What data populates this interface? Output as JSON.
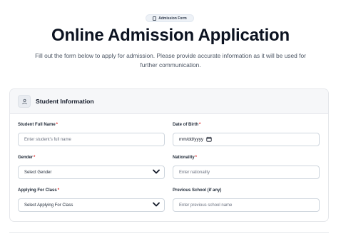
{
  "badge": {
    "label": "Admission Form",
    "icon": "document-icon"
  },
  "page": {
    "title": "Online Admission Application",
    "subtitle": "Fill out the form below to apply for admission. Please provide accurate information as it will be used for further communication."
  },
  "section": {
    "title": "Student Information",
    "icon": "user-icon"
  },
  "fields": {
    "full_name": {
      "label": "Student Full Name",
      "required_mark": "*",
      "placeholder": "Enter student's full name"
    },
    "dob": {
      "label": "Date of Birth",
      "required_mark": "*",
      "value": "mm/dd/yyyy",
      "icon": "calendar-icon"
    },
    "gender": {
      "label": "Gender",
      "required_mark": "*",
      "selected": "Select Gender",
      "icon": "chevron-down-icon"
    },
    "nationality": {
      "label": "Nationality",
      "required_mark": "*",
      "placeholder": "Enter nationality"
    },
    "class": {
      "label": "Applying For Class",
      "required_mark": "*",
      "selected": "Select Applying For Class",
      "icon": "chevron-down-icon"
    },
    "previous_school": {
      "label": "Previous School (if any)",
      "placeholder": "Enter previous school name"
    }
  },
  "colors": {
    "required": "#dc2626",
    "border": "#cfd6de",
    "header_bg": "#f6f7f9"
  }
}
